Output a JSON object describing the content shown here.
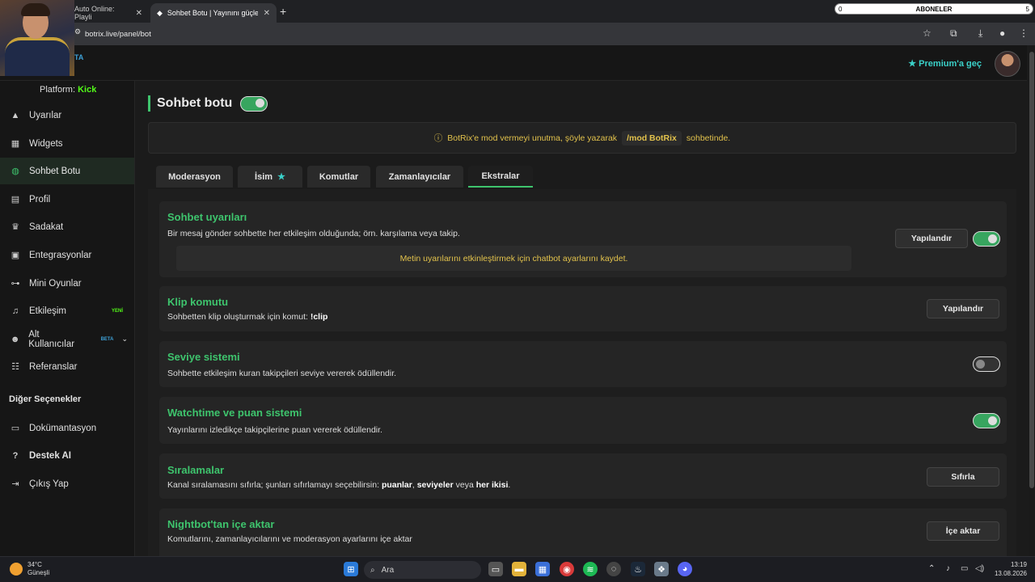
{
  "browser": {
    "tabs": [
      {
        "label": "Auto Online: Playli",
        "close": "✕"
      },
      {
        "label": "Sohbet Botu | Yayınını güçlendi",
        "close": "✕"
      }
    ],
    "new_tab": "+",
    "url": "botrix.live/panel/bot",
    "overlay": {
      "count": "0",
      "label": "ABONELER",
      "count_right": "5"
    }
  },
  "header": {
    "beta_fragment": "TA",
    "premium_label": "Premium'a geç"
  },
  "sidebar": {
    "platform_label": "Platform:",
    "platform_value": "Kick",
    "items": [
      {
        "label": "Uyarılar",
        "icon": "warning-icon"
      },
      {
        "label": "Widgets",
        "icon": "widgets-icon"
      },
      {
        "label": "Sohbet Botu",
        "icon": "robot-icon"
      },
      {
        "label": "Profil",
        "icon": "id-card-icon"
      },
      {
        "label": "Sadakat",
        "icon": "trophy-icon"
      },
      {
        "label": "Entegrasyonlar",
        "icon": "plug-icon"
      },
      {
        "label": "Mini Oyunlar",
        "icon": "gamepad-icon"
      },
      {
        "label": "Etkileşim",
        "icon": "music-icon",
        "badge": "YENİ"
      },
      {
        "label": "Alt Kullanıcılar",
        "icon": "users-icon",
        "badge": "BETA"
      },
      {
        "label": "Referanslar",
        "icon": "user-group-icon"
      }
    ],
    "other_heading": "Diğer Seçenekler",
    "other_items": [
      {
        "label": "Dokümantasyon",
        "icon": "docs-icon"
      },
      {
        "label": "Destek AI",
        "icon": "help-icon"
      },
      {
        "label": "Çıkış Yap",
        "icon": "logout-icon"
      }
    ]
  },
  "main": {
    "title": "Sohbet botu",
    "notice": {
      "before": "BotRix'e mod vermeyi unutma, şöyle yazarak",
      "code": "/mod BotRix",
      "after": "sohbetinde."
    },
    "tabs": [
      "Moderasyon",
      "İsim",
      "Komutlar",
      "Zamanlayıcılar",
      "Ekstralar"
    ],
    "cards": {
      "alerts": {
        "title": "Sohbet uyarıları",
        "desc": "Bir mesaj gönder sohbette her etkileşim olduğunda; örn. karşılama veya takip.",
        "button": "Yapılandır",
        "note": "Metin uyarılarını etkinleştirmek için chatbot ayarlarını kaydet.",
        "enabled": true
      },
      "clip": {
        "title": "Klip komutu",
        "desc_prefix": "Sohbetten klip oluşturmak için komut:",
        "command": "!clip",
        "button": "Yapılandır"
      },
      "level": {
        "title": "Seviye sistemi",
        "desc": "Sohbette etkileşim kuran takipçileri seviye vererek ödüllendir.",
        "enabled": false
      },
      "watchtime": {
        "title": "Watchtime ve puan sistemi",
        "desc": "Yayınlarını izledikçe takipçilerine puan vererek ödüllendir.",
        "enabled": true
      },
      "ranking": {
        "title": "Sıralamalar",
        "desc_prefix": "Kanal sıralamasını sıfırla; şunları sıfırlamayı seçebilirsin:",
        "opt1": "puanlar",
        "sep": ",",
        "opt2": "seviyeler",
        "veya": "veya",
        "opt3": "her ikisi",
        "end": ".",
        "button": "Sıfırla"
      },
      "nightbot": {
        "title": "Nightbot'tan içe aktar",
        "desc": "Komutlarını, zamanlayıcılarını ve moderasyon ayarlarını içe aktar",
        "button": "İçe aktar"
      }
    }
  },
  "taskbar": {
    "weather_temp": "34°C",
    "weather_desc": "Güneşli",
    "search_placeholder": "Ara",
    "time": "13:19",
    "date": "13.08.2026"
  },
  "colors": {
    "accent": "#3ec46d",
    "kick": "#53fc18",
    "warning": "#e2c24c",
    "premium": "#3ad0c8"
  }
}
